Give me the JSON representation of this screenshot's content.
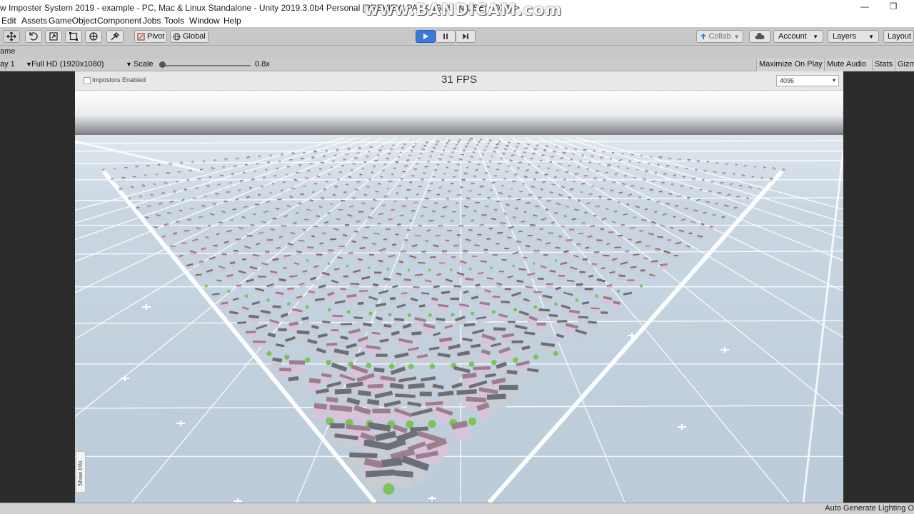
{
  "window": {
    "title": "w Imposter System 2019 - example - PC, Mac & Linux Standalone - Unity 2019.3.0b4 Personal [PREVIEW PACKAGES IN USE] <DX11>",
    "watermark": "www.BANDICAM.com",
    "minimize_glyph": "—",
    "restore_glyph": "❐"
  },
  "menu": [
    "Edit",
    "Assets",
    "GameObject",
    "Component",
    "Jobs",
    "Tools",
    "Window",
    "Help"
  ],
  "toolbar": {
    "pivot_label": "Pivot",
    "global_label": "Global",
    "collab_label": "Collab",
    "account_label": "Account",
    "layers_label": "Layers",
    "layout_label": "Layout"
  },
  "tab": {
    "label": "ame"
  },
  "game_bar": {
    "display_label": "ay 1",
    "resolution_label": "Full HD (1920x1080)",
    "scale_label": "Scale",
    "scale_value": "0.8x",
    "scale_level": 0.02,
    "maximize_label": "Maximize On Play",
    "mute_label": "Mute Audio",
    "stats_label": "Stats",
    "gizmos_label": "Gizm"
  },
  "overlay": {
    "impostors_label": "Impostors Enabled",
    "impostors_checked": false,
    "fps": "31 FPS",
    "texture_size": "4096",
    "show_info": "Show Info"
  },
  "status": {
    "text": "Auto Generate Lighting O"
  },
  "colors": {
    "play_accent": "#3b7ad8",
    "sky_top": "#ffffff",
    "horizon": "#7e7e82",
    "ground": "#c5d2de",
    "building_roof": "#8a6a6c",
    "building_pink": "#d8c4da",
    "tree": "#7ec35a"
  }
}
